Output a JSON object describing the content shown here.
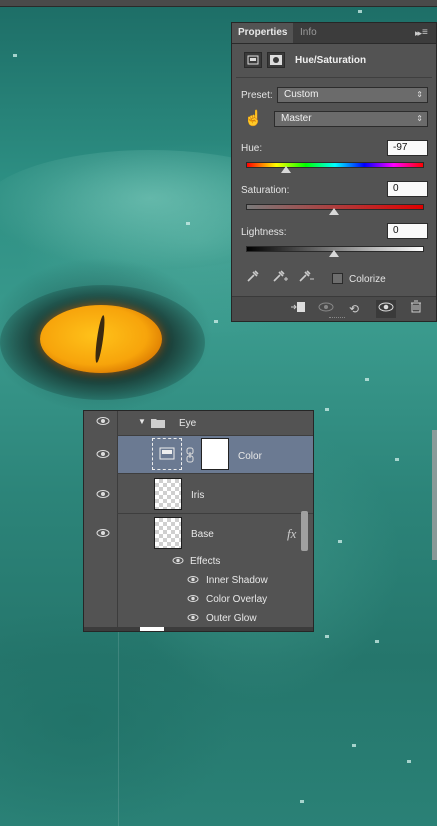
{
  "properties_panel": {
    "tabs": [
      "Properties",
      "Info"
    ],
    "menu_glyph": "▸▸",
    "flyout_glyph": "≡",
    "adjustment_icon": "hue-saturation-adjustment-icon",
    "mask_icon": "layer-mask-icon",
    "title": "Hue/Saturation",
    "preset_label": "Preset:",
    "preset_value": "Custom",
    "channel_value": "Master",
    "hue_label": "Hue:",
    "hue_value": "-97",
    "saturation_label": "Saturation:",
    "saturation_value": "0",
    "lightness_label": "Lightness:",
    "lightness_value": "0",
    "colorize_label": "Colorize",
    "colorize_checked": false,
    "hue_fraction": 0.23,
    "saturation_fraction": 0.5,
    "lightness_fraction": 0.5,
    "bottom_icons": [
      "clip-to-layer-icon",
      "view-previous-state-icon",
      "reset-icon",
      "visibility-icon",
      "trash-icon"
    ],
    "glyphs": {
      "hand": "☝",
      "eyedropper": "⊿",
      "undo": "⟲",
      "eye": "◉",
      "trash": "🗑",
      "clip": "⬛▫",
      "prev": "◎"
    }
  },
  "layers_panel": {
    "group_name": "Eye",
    "layers": [
      {
        "name": "Color",
        "selected": true
      },
      {
        "name": "Iris",
        "selected": false
      },
      {
        "name": "Base",
        "selected": false
      }
    ],
    "fx_label": "fx",
    "effects_label": "Effects",
    "effects": [
      "Inner Shadow",
      "Color Overlay",
      "Outer Glow"
    ],
    "eye_glyph": "●",
    "small_eye_glyph": "●",
    "folder_glyph": "▬",
    "disclosure_glyph": "▼",
    "link_glyph": "⛓"
  },
  "colors": {
    "panel_bg": "#535353",
    "selected_row": "#6b7a92",
    "canvas_teal": "#2f8a80",
    "iris_orange": "#f7a40b"
  }
}
